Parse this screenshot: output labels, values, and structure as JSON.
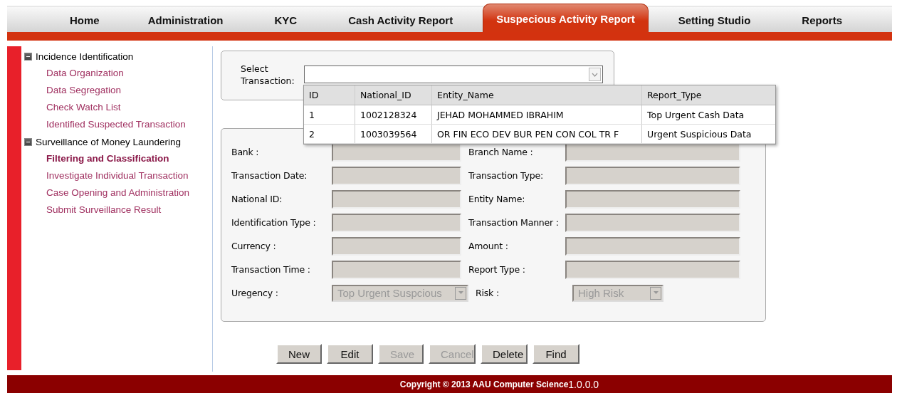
{
  "nav": {
    "tabs": [
      {
        "label": "Home",
        "selected": false
      },
      {
        "label": "Administration",
        "selected": false
      },
      {
        "label": "KYC",
        "selected": false
      },
      {
        "label": "Cash Activity Report",
        "selected": false
      },
      {
        "label": "Suspecious Activity Report",
        "selected": true
      },
      {
        "label": "Setting Studio",
        "selected": false
      },
      {
        "label": "Reports",
        "selected": false
      }
    ]
  },
  "sidebar": {
    "items": [
      {
        "label": "Incidence Identification",
        "expanded": true,
        "children": [
          {
            "label": "Data Organization",
            "selected": false
          },
          {
            "label": "Data Segregation",
            "selected": false
          },
          {
            "label": "Check Watch List",
            "selected": false
          },
          {
            "label": "Identified Suspected Transaction",
            "selected": false
          }
        ]
      },
      {
        "label": "Surveillance of Money Laundering",
        "expanded": true,
        "children": [
          {
            "label": "Filtering and Classification",
            "selected": true
          },
          {
            "label": "Investigate Individual Transaction",
            "selected": false
          },
          {
            "label": "Case Opening and Administration",
            "selected": false
          },
          {
            "label": "Submit Surveillance Result",
            "selected": false
          }
        ]
      }
    ]
  },
  "select_transaction": {
    "label": "Select Transaction:",
    "dropdown": {
      "columns": [
        "ID",
        "National_ID",
        "Entity_Name",
        "Report_Type"
      ],
      "rows": [
        [
          "1",
          "1002128324",
          "JEHAD MOHAMMED IBRAHIM",
          "Top Urgent Cash Data"
        ],
        [
          "2",
          "1003039564",
          "OR FIN ECO DEV BUR PEN CON COL TR F",
          "Urgent Suspicious Data"
        ]
      ]
    }
  },
  "form": {
    "rows": [
      [
        {
          "label": "Bank :",
          "kind": "text"
        },
        {
          "label": "Branch Name :",
          "kind": "text"
        }
      ],
      [
        {
          "label": "Transaction Date:",
          "kind": "text"
        },
        {
          "label": "Transaction Type:",
          "kind": "text"
        }
      ],
      [
        {
          "label": "National ID:",
          "kind": "text"
        },
        {
          "label": "Entity Name:",
          "kind": "text"
        }
      ],
      [
        {
          "label": "Identification Type :",
          "kind": "text"
        },
        {
          "label": "Transaction Manner :",
          "kind": "text"
        }
      ],
      [
        {
          "label": "Currency :",
          "kind": "text"
        },
        {
          "label": "Amount :",
          "kind": "text"
        }
      ],
      [
        {
          "label": "Transaction Time :",
          "kind": "text"
        },
        {
          "label": "Report Type :",
          "kind": "text"
        }
      ],
      [
        {
          "label": "Uregency :",
          "kind": "select",
          "value": "Top Urgent Suspcious"
        },
        {
          "label": "Risk :",
          "kind": "select",
          "value": "High Risk"
        }
      ]
    ]
  },
  "buttons": [
    {
      "label": "New",
      "disabled": false
    },
    {
      "label": "Edit",
      "disabled": false
    },
    {
      "label": "Save",
      "disabled": true
    },
    {
      "label": "Cancel",
      "disabled": true
    },
    {
      "label": "Delete",
      "disabled": false
    },
    {
      "label": "Find",
      "disabled": false
    }
  ],
  "footer": {
    "copyright": "Copyright © 2013 AAU Computer Science",
    "version": "1.0.0.0"
  }
}
